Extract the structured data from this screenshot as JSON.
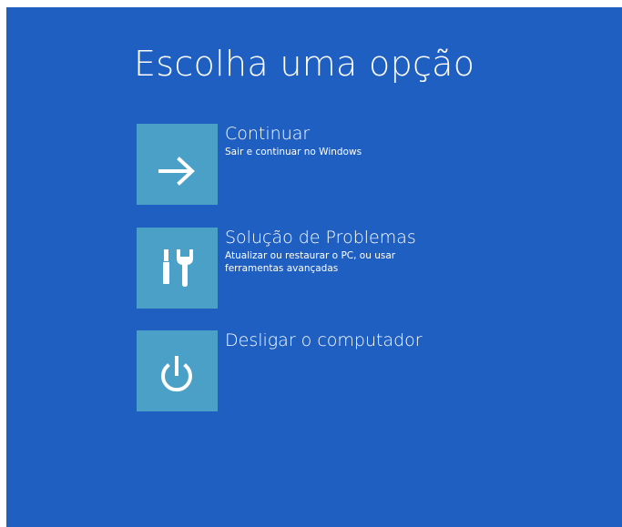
{
  "page": {
    "title": "Escolha uma opção"
  },
  "options": [
    {
      "title": "Continuar",
      "description": "Sair e continuar no Windows",
      "icon": "arrow-right-icon"
    },
    {
      "title": "Solução de Problemas",
      "description": "Atualizar ou restaurar o PC, ou usar ferramentas avançadas",
      "icon": "tools-icon"
    },
    {
      "title": "Desligar o computador",
      "description": "",
      "icon": "power-icon"
    }
  ],
  "colors": {
    "background": "#1f5fc2",
    "tile": "#4aa0c6",
    "text": "#ffffff"
  }
}
